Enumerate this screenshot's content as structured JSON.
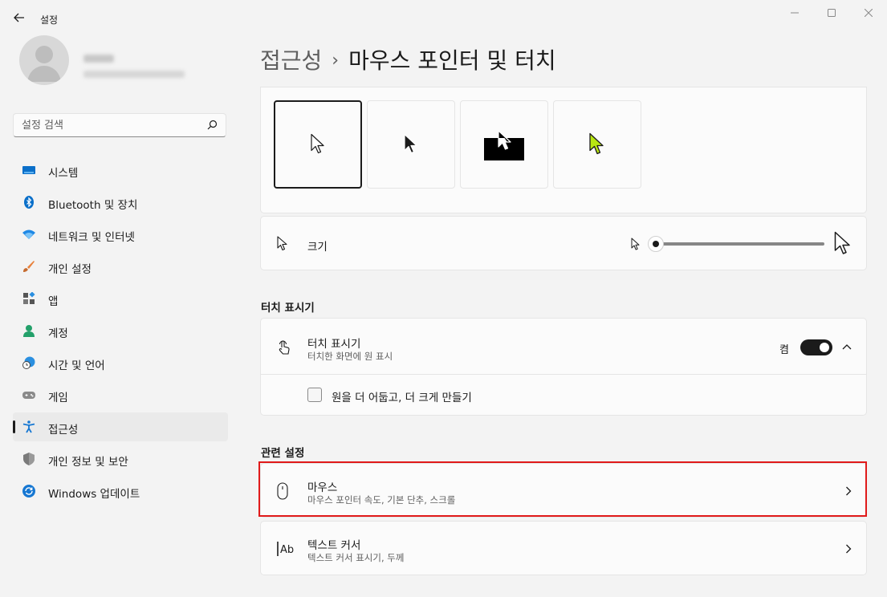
{
  "app": {
    "title": "설정",
    "back_icon": "back-arrow-icon",
    "window_controls": [
      "minimize-icon",
      "maximize-icon",
      "close-icon"
    ]
  },
  "search": {
    "placeholder": "설정 검색",
    "value": "",
    "icon": "search-icon"
  },
  "sidebar": {
    "items": [
      {
        "label": "시스템",
        "icon": "system-icon",
        "selected": false
      },
      {
        "label": "Bluetooth 및 장치",
        "icon": "bluetooth-icon",
        "selected": false
      },
      {
        "label": "네트워크 및 인터넷",
        "icon": "network-icon",
        "selected": false
      },
      {
        "label": "개인 설정",
        "icon": "personalization-icon",
        "selected": false
      },
      {
        "label": "앱",
        "icon": "apps-icon",
        "selected": false
      },
      {
        "label": "계정",
        "icon": "accounts-icon",
        "selected": false
      },
      {
        "label": "시간 및 언어",
        "icon": "time-language-icon",
        "selected": false
      },
      {
        "label": "게임",
        "icon": "gaming-icon",
        "selected": false
      },
      {
        "label": "접근성",
        "icon": "accessibility-icon",
        "selected": true
      },
      {
        "label": "개인 정보 및 보안",
        "icon": "privacy-shield-icon",
        "selected": false
      },
      {
        "label": "Windows 업데이트",
        "icon": "windows-update-icon",
        "selected": false
      }
    ]
  },
  "header": {
    "breadcrumb_parent": "접근성",
    "separator": "›",
    "page_title": "마우스 포인터 및 터치"
  },
  "pointer_style": {
    "options": [
      "white",
      "black",
      "inverted",
      "custom"
    ],
    "selected_index": 0,
    "custom_color": "#b8e611"
  },
  "size": {
    "label": "크기",
    "value_fraction": 0.0
  },
  "touch": {
    "section_title": "터치 표시기",
    "row_title": "터치 표시기",
    "row_subtitle": "터치한 화면에 원 표시",
    "toggle_state": "켬",
    "toggle_on": true,
    "checkbox_label": "원을 더 어둡고, 더 크게 만들기",
    "checkbox_checked": false
  },
  "related": {
    "section_title": "관련 설정",
    "items": [
      {
        "title": "마우스",
        "subtitle": "마우스 포인터 속도, 기본 단추, 스크롤",
        "icon": "mouse-icon"
      },
      {
        "title": "텍스트 커서",
        "subtitle": "텍스트 커서 표시기, 두께",
        "icon": "text-cursor-icon"
      }
    ]
  },
  "colors": {
    "highlight": "#e01a1a",
    "toggle_on": "#1b1b1b",
    "accent_blue": "#0067c0"
  }
}
